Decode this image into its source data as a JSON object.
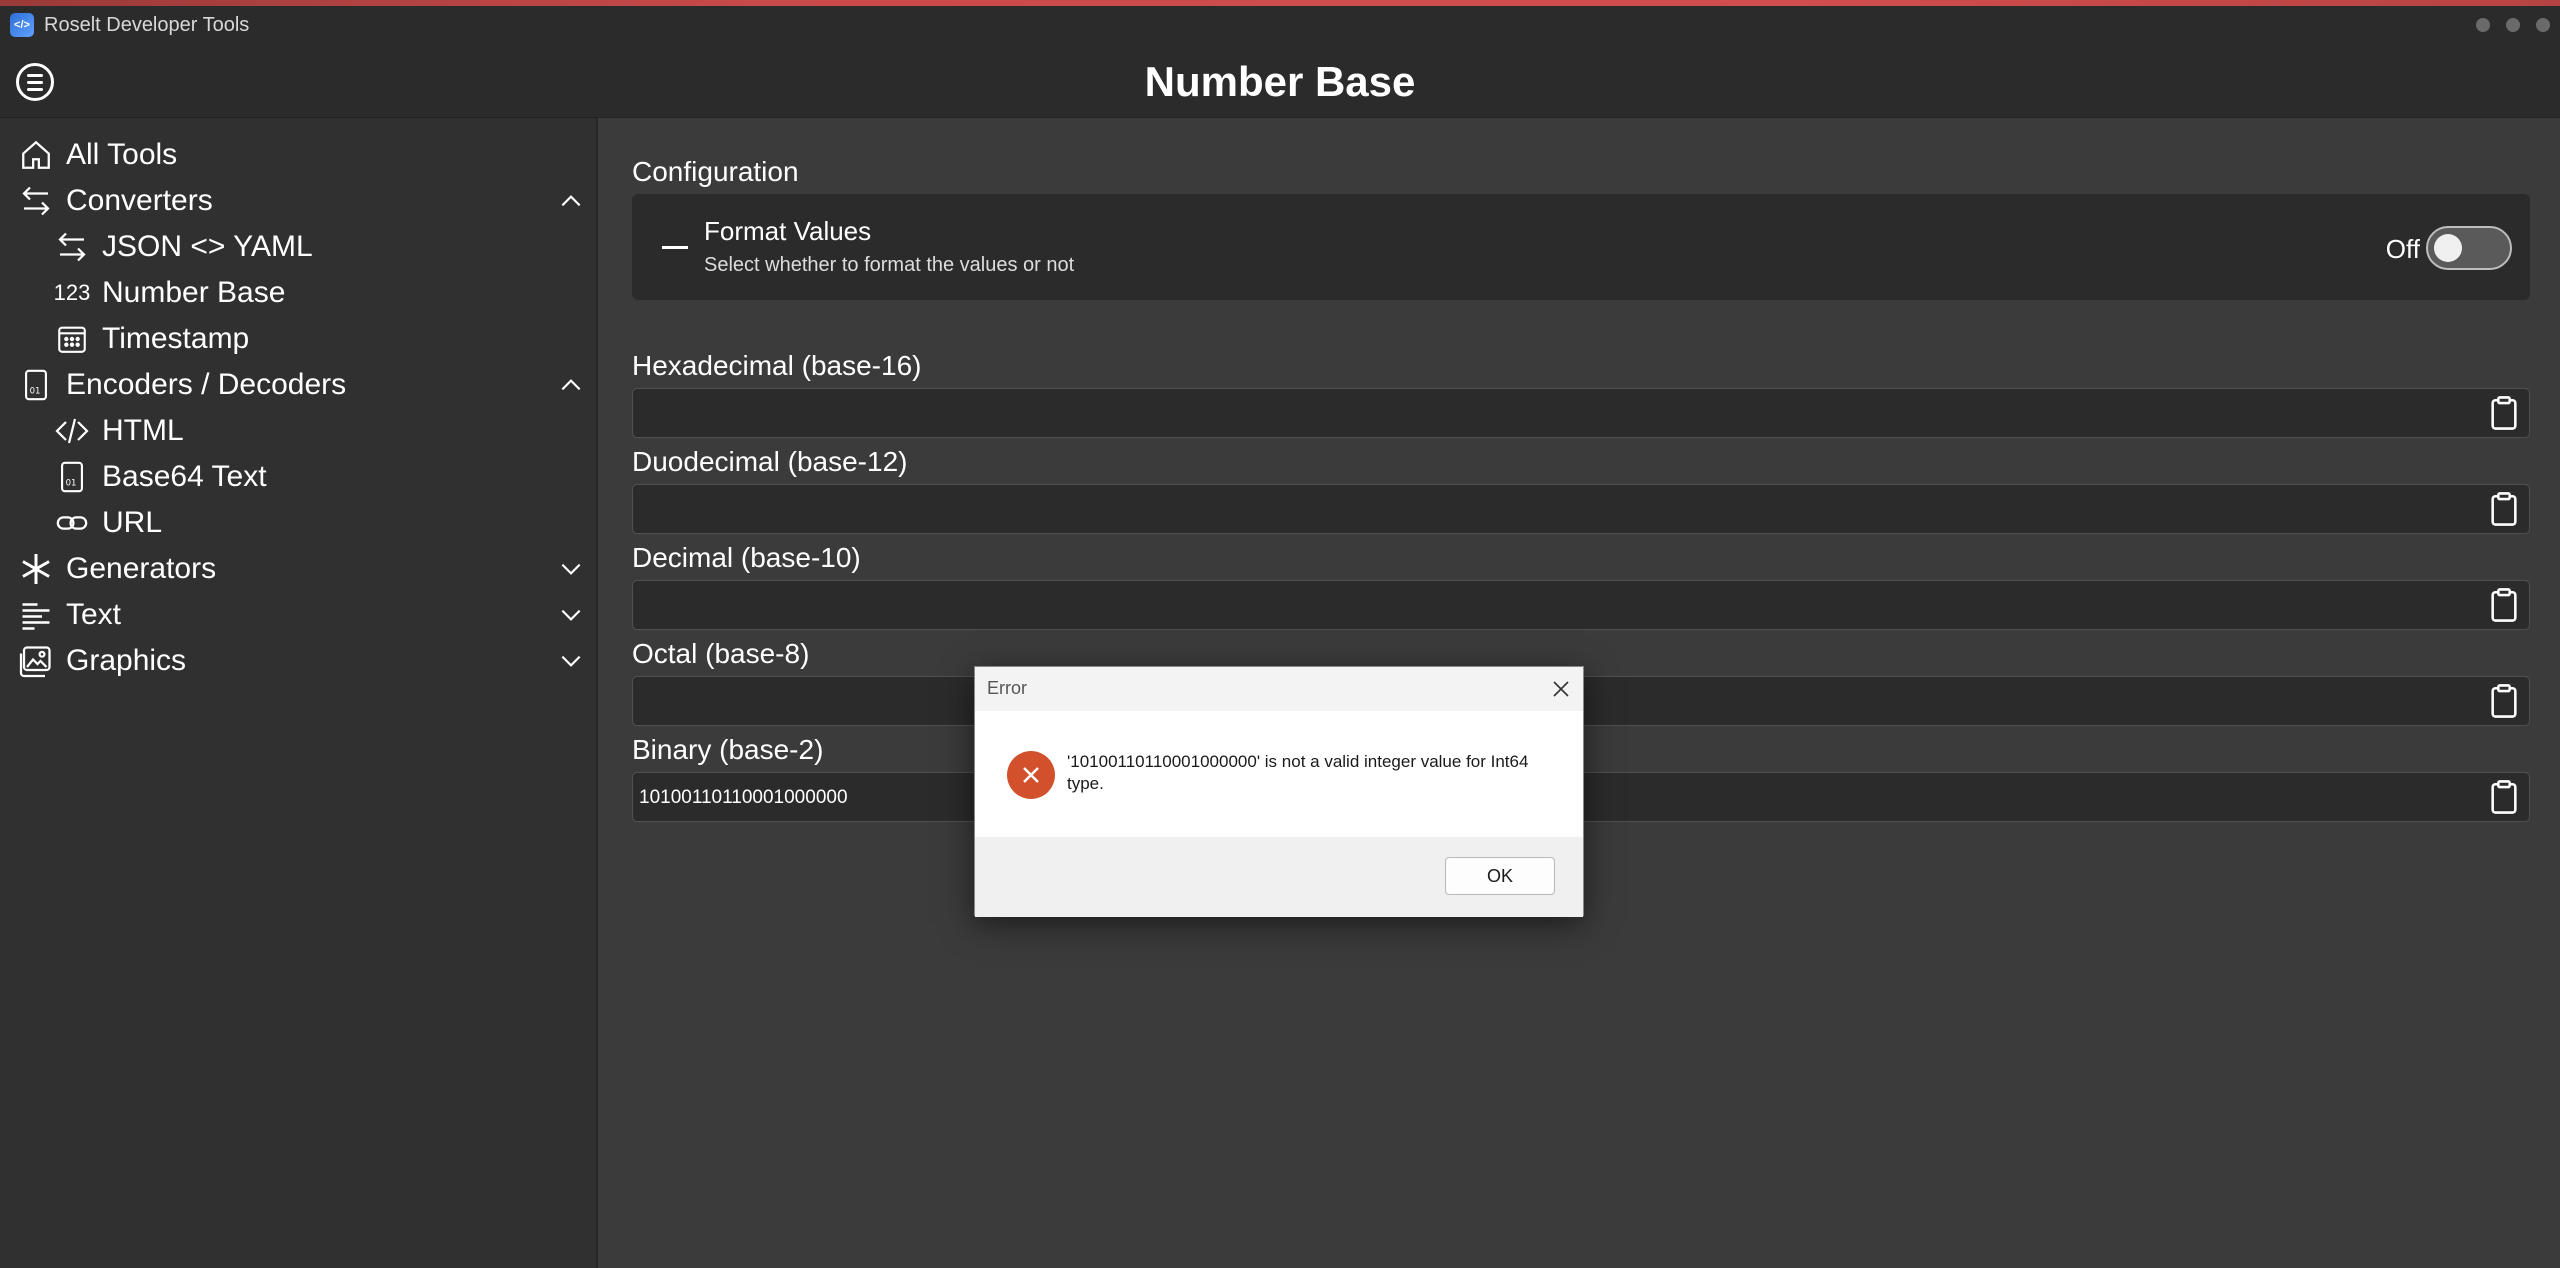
{
  "window": {
    "title": "Roselt Developer Tools"
  },
  "header": {
    "title": "Number Base"
  },
  "sidebar": {
    "items": [
      {
        "label": "All Tools"
      },
      {
        "label": "Converters"
      },
      {
        "label": "JSON <> YAML"
      },
      {
        "label": "Number Base",
        "icon_text": "123"
      },
      {
        "label": "Timestamp"
      },
      {
        "label": "Encoders / Decoders"
      },
      {
        "label": "HTML"
      },
      {
        "label": "Base64 Text"
      },
      {
        "label": "URL"
      },
      {
        "label": "Generators"
      },
      {
        "label": "Text"
      },
      {
        "label": "Graphics"
      }
    ]
  },
  "main": {
    "configuration_title": "Configuration",
    "format_values": {
      "title": "Format Values",
      "description": "Select whether to format the values or not",
      "state_label": "Off",
      "enabled": false
    },
    "fields": [
      {
        "label": "Hexadecimal (base-16)",
        "value": ""
      },
      {
        "label": "Duodecimal (base-12)",
        "value": ""
      },
      {
        "label": "Decimal (base-10)",
        "value": ""
      },
      {
        "label": "Octal (base-8)",
        "value": ""
      },
      {
        "label": "Binary (base-2)",
        "value": "10100110110001000000"
      }
    ]
  },
  "dialog": {
    "title": "Error",
    "message": "'10100110110001000000' is not a valid integer value for Int64 type.",
    "ok_label": "OK"
  }
}
